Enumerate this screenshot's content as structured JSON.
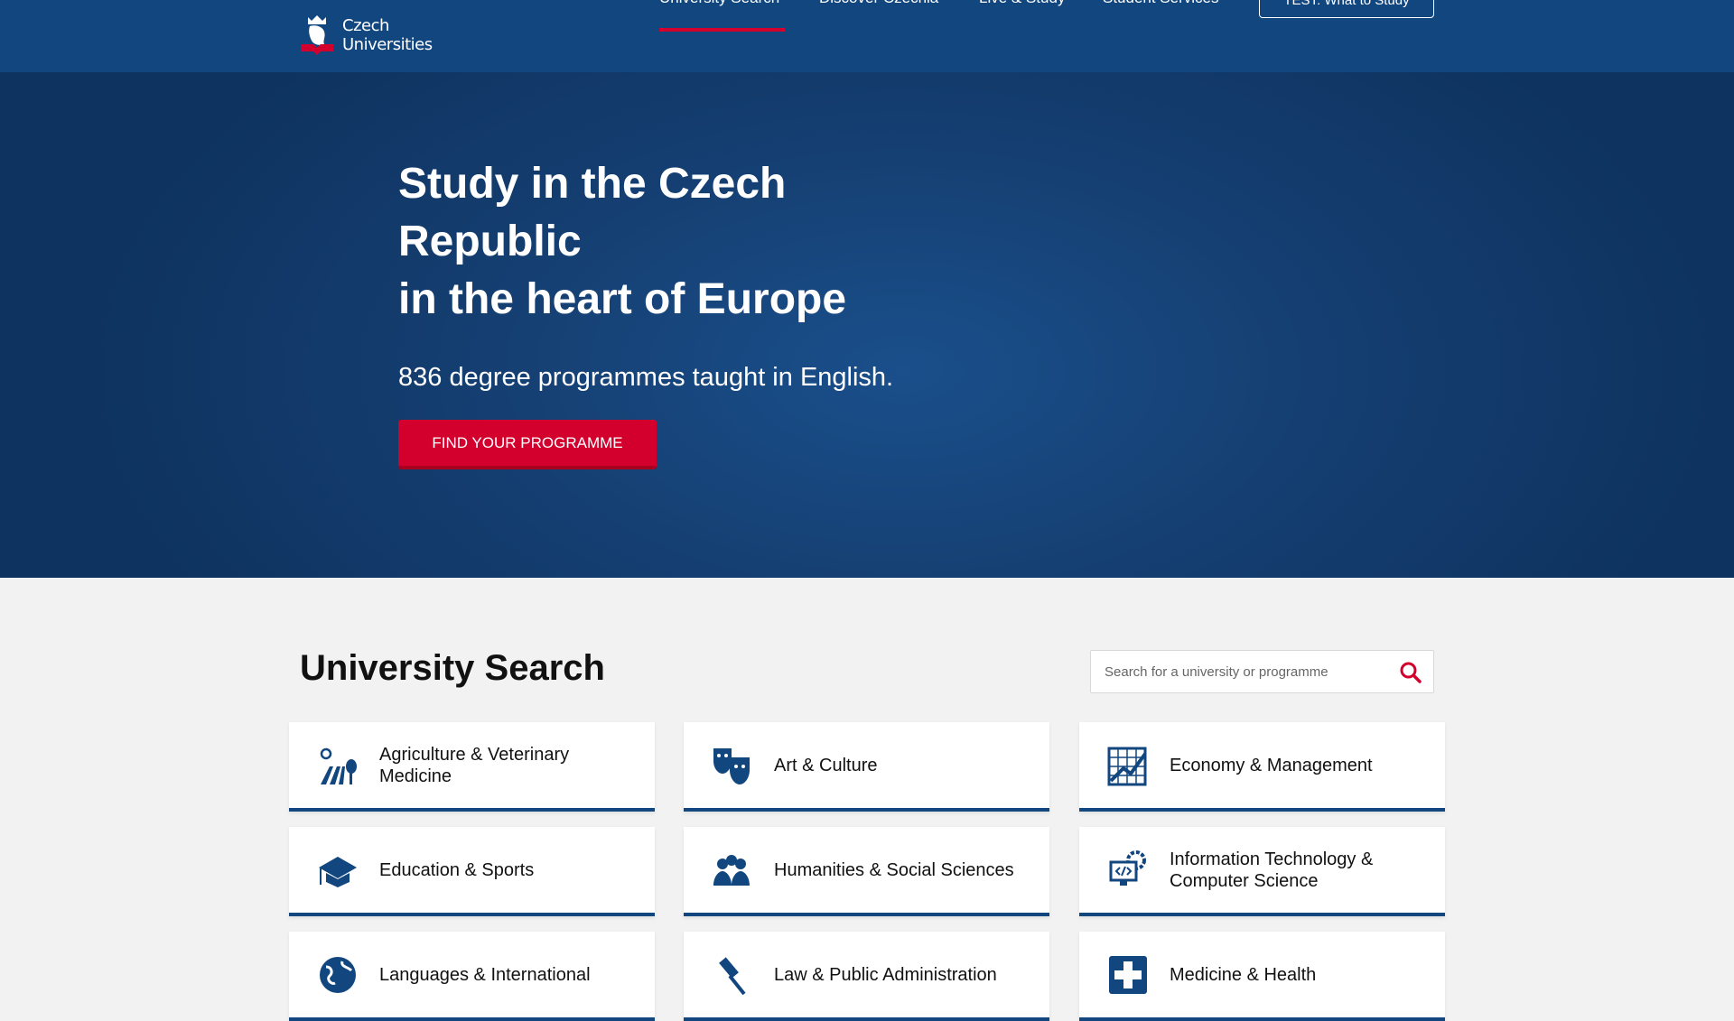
{
  "header": {
    "logo_line1": "Czech",
    "logo_line2": "Universities",
    "nav": [
      "University Search",
      "Discover Czechia",
      "Live & Study",
      "Student Services"
    ],
    "test_button": "TEST: What to Study"
  },
  "hero": {
    "title_line1": "Study in the Czech",
    "title_line2": "Republic",
    "title_line3": "in the heart of Europe",
    "subtitle": "836 degree programmes taught in English.",
    "cta": "FIND YOUR PROGRAMME"
  },
  "search_section": {
    "title": "University Search",
    "search_placeholder": "Search for a university or programme"
  },
  "categories": [
    {
      "label": "Agriculture & Veterinary Medicine",
      "icon": "agriculture-icon"
    },
    {
      "label": "Art & Culture",
      "icon": "theatre-masks-icon"
    },
    {
      "label": "Economy & Management",
      "icon": "chart-icon"
    },
    {
      "label": "Education & Sports",
      "icon": "graduation-cap-icon"
    },
    {
      "label": "Humanities & Social Sciences",
      "icon": "people-icon"
    },
    {
      "label": "Information Technology & Computer Science",
      "icon": "computer-code-icon"
    },
    {
      "label": "Languages & International",
      "icon": "globe-icon"
    },
    {
      "label": "Law & Public Administration",
      "icon": "gavel-icon"
    },
    {
      "label": "Medicine & Health",
      "icon": "medical-cross-icon"
    }
  ],
  "colors": {
    "navy": "#12467f",
    "red": "#d3002e"
  }
}
